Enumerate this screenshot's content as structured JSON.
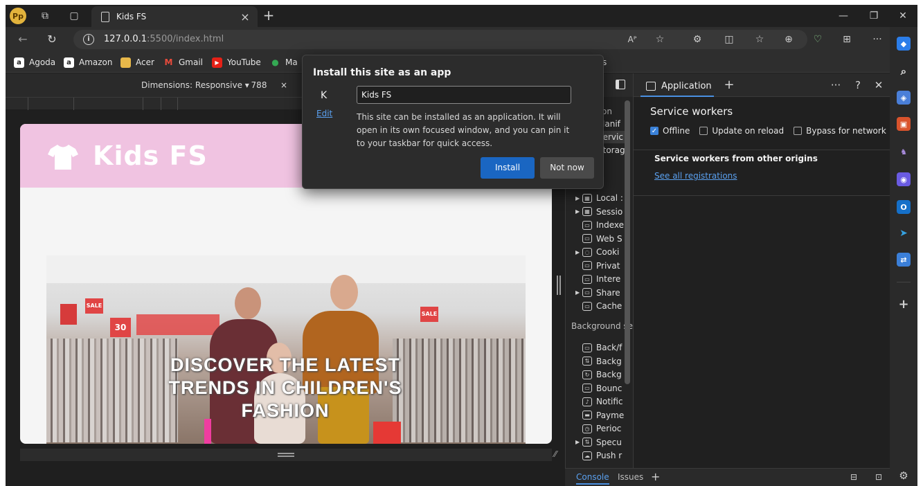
{
  "browser": {
    "profile_initials": "Pp",
    "tab_title": "Kids FS",
    "url_host": "127.0.0.1",
    "url_path": ":5500/index.html",
    "read_aloud_label": "Aᴾ"
  },
  "bookmarks": [
    {
      "label": "Agoda",
      "icon": "agoda-icon",
      "glyph": "a"
    },
    {
      "label": "Amazon",
      "icon": "amazon-icon",
      "glyph": "a"
    },
    {
      "label": "Acer",
      "icon": "folder-icon",
      "glyph": ""
    },
    {
      "label": "Gmail",
      "icon": "gmail-icon",
      "glyph": "M"
    },
    {
      "label": "YouTube",
      "icon": "youtube-icon",
      "glyph": "▶"
    },
    {
      "label": "Ma",
      "icon": "maps-icon",
      "glyph": "●"
    },
    {
      "label": "ks",
      "icon": "",
      "glyph": ""
    }
  ],
  "responsive": {
    "dimensions_label": "Dimensions: Responsive ▾",
    "width_value": "788",
    "times": "×"
  },
  "site": {
    "logo_text": "Kids FS",
    "hero_text": "DISCOVER THE LATEST TRENDS IN CHILDREN'S FASHION",
    "sale_tag": "SALE",
    "sale_num": "30"
  },
  "dialog": {
    "title": "Install this site as an app",
    "app_initial": "K",
    "edit_label": "Edit",
    "name_value": "Kids FS",
    "description": "This site can be installed as an application. It will open in its own focused window, and you can pin it to your taskbar for quick access.",
    "install_label": "Install",
    "notnow_label": "Not now"
  },
  "devtools": {
    "tree_heading": "tion",
    "tree_top": [
      "Manif",
      "Servic",
      "Storag"
    ],
    "storage_items": [
      {
        "label": "Local :",
        "icon": "table-icon",
        "expandable": true
      },
      {
        "label": "Sessio",
        "icon": "table-icon",
        "expandable": true
      },
      {
        "label": "Indexe",
        "icon": "database-icon",
        "expandable": false
      },
      {
        "label": "Web S",
        "icon": "database-icon",
        "expandable": false
      },
      {
        "label": "Cooki",
        "icon": "cookie-icon",
        "expandable": true
      },
      {
        "label": "Privat",
        "icon": "database-icon",
        "expandable": false
      },
      {
        "label": "Intere",
        "icon": "database-icon",
        "expandable": false
      },
      {
        "label": "Share",
        "icon": "database-icon",
        "expandable": true
      },
      {
        "label": "Cache",
        "icon": "database-icon",
        "expandable": false
      }
    ],
    "background_heading": "Background se",
    "background_items": [
      {
        "label": "Back/f",
        "icon": "database-icon",
        "expandable": false
      },
      {
        "label": "Backg",
        "icon": "sync-arrows-icon",
        "expandable": false
      },
      {
        "label": "Backg",
        "icon": "refresh-icon",
        "expandable": false
      },
      {
        "label": "Bounc",
        "icon": "database-icon",
        "expandable": false
      },
      {
        "label": "Notific",
        "icon": "bell-icon",
        "expandable": false
      },
      {
        "label": "Payme",
        "icon": "card-icon",
        "expandable": false
      },
      {
        "label": "Perioc",
        "icon": "clock-icon",
        "expandable": false
      },
      {
        "label": "Specu",
        "icon": "sync-arrows-icon",
        "expandable": true
      },
      {
        "label": "Push r",
        "icon": "cloud-icon",
        "expandable": false
      }
    ],
    "active_tab": "Application",
    "sw_title": "Service workers",
    "checks": [
      {
        "label": "Offline",
        "checked": true
      },
      {
        "label": "Update on reload",
        "checked": false
      },
      {
        "label": "Bypass for network",
        "checked": false
      }
    ],
    "other_origins": "Service workers from other origins",
    "see_all": "See all registrations",
    "drawer_console": "Console",
    "drawer_issues": "Issues"
  },
  "colors": {
    "accent": "#1a66c2",
    "site_header": "#f0c3e1",
    "link": "#5aa0ef"
  }
}
